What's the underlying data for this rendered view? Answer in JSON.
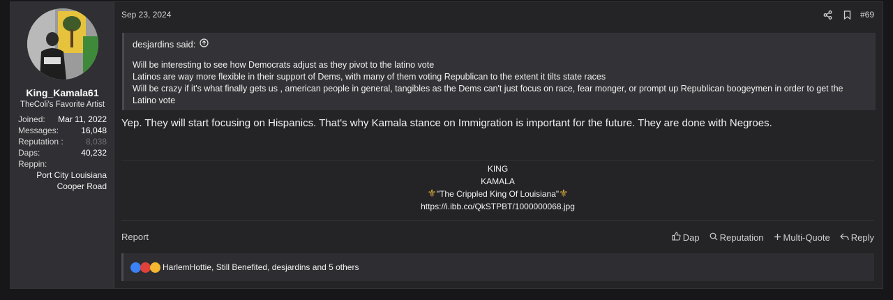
{
  "user": {
    "username": "King_Kamala61",
    "title": "TheColi's Favorite Artist",
    "stats": [
      {
        "key": "Joined:",
        "value": "Mar 11, 2022"
      },
      {
        "key": "Messages:",
        "value": "16,048"
      },
      {
        "key": "Reputation :",
        "value": "8,038"
      },
      {
        "key": "Daps:",
        "value": "40,232"
      },
      {
        "key": "Reppin:",
        "value": ""
      }
    ],
    "reppin": [
      "Port City Louisiana",
      "Cooper Road"
    ]
  },
  "post": {
    "date": "Sep 23, 2024",
    "number": "#69",
    "icons": [
      "share-icon",
      "bookmark-icon"
    ],
    "quote": {
      "author": "desjardins said:",
      "lines": [
        "Will be interesting to see how Democrats adjust as they pivot to the latino vote",
        "Latinos are way more flexible in their support of Dems, with many of them voting Republican to the extent it tilts state races",
        "Will be crazy if it's what finally gets us , american people in general, tangibles as the Dems can't just focus on race, fear monger, or prompt up Republican boogeymen in order to get the",
        "Latino vote"
      ]
    },
    "message": "Yep. They will start focusing on Hispanics. That's why Kamala stance on Immigration is important for the future. They are done with Negroes.",
    "signature": {
      "line1": "KING",
      "line2": "KAMALA",
      "line3": "\"The Crippled King Of Louisiana\"",
      "link": "https://i.ibb.co/QkSTPBT/1000000068.jpg",
      "fleur": "⚜"
    },
    "footer": {
      "report": "Report",
      "actions": {
        "dap": "Dap",
        "reputation": "Reputation",
        "multiquote": "Multi-Quote",
        "reply": "Reply"
      }
    },
    "reactions": {
      "text": "HarlemHottie, Still Benefited, desjardins and 5 others",
      "colors": [
        "#3b82f6",
        "#e0413a",
        "#f2b630"
      ]
    }
  }
}
